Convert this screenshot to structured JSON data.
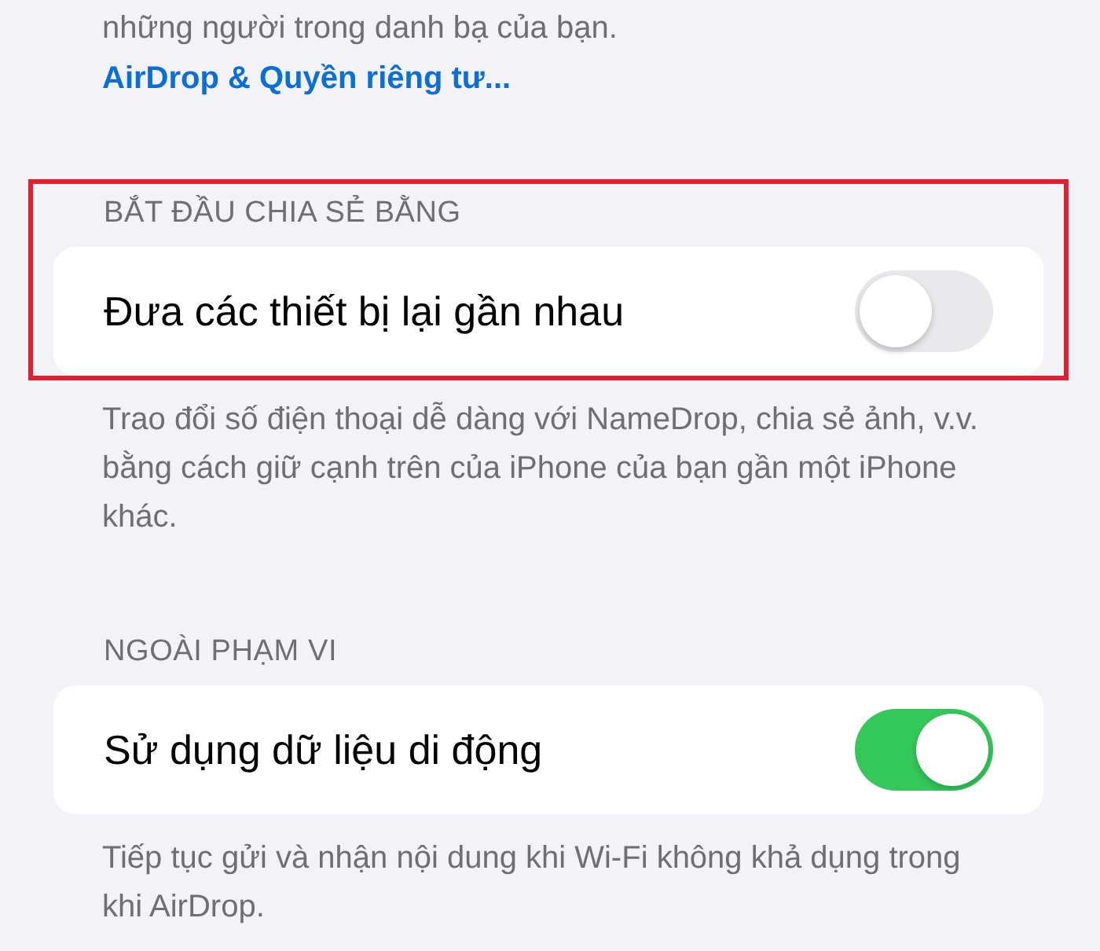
{
  "intro": {
    "text": "những người trong danh bạ của bạn.",
    "link": "AirDrop & Quyền riêng tư..."
  },
  "sections": [
    {
      "header": "BẮT ĐẦU CHIA SẺ BẰNG",
      "highlighted": true,
      "row": {
        "label": "Đưa các thiết bị lại gần nhau",
        "on": false
      },
      "footer": "Trao đổi số điện thoại dễ dàng với NameDrop, chia sẻ ảnh, v.v. bằng cách giữ cạnh trên của iPhone của bạn gần một iPhone khác."
    },
    {
      "header": "NGOÀI PHẠM VI",
      "highlighted": false,
      "row": {
        "label": "Sử dụng dữ liệu di động",
        "on": true
      },
      "footer": "Tiếp tục gửi và nhận nội dung khi Wi-Fi không khả dụng trong khi AirDrop."
    }
  ]
}
